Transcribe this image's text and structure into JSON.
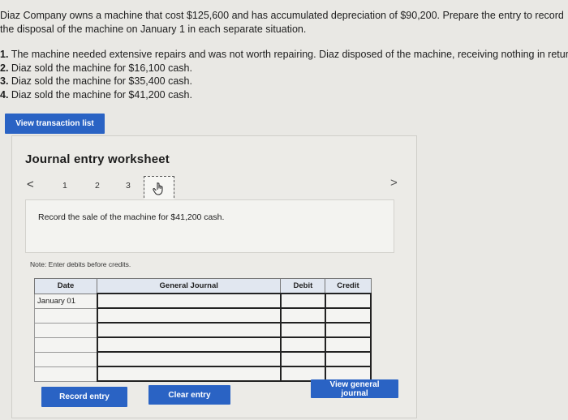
{
  "problem": {
    "intro": "Diaz Company owns a machine that cost $125,600 and has accumulated depreciation of $90,200. Prepare the entry to record the disposal of the machine on January 1 in each separate situation.",
    "items": [
      {
        "num": "1.",
        "text": "The machine needed extensive repairs and was not worth repairing. Diaz disposed of the machine, receiving nothing in return."
      },
      {
        "num": "2.",
        "text": "Diaz sold the machine for $16,100 cash."
      },
      {
        "num": "3.",
        "text": "Diaz sold the machine for $35,400 cash."
      },
      {
        "num": "4.",
        "text": "Diaz sold the machine for $41,200 cash."
      }
    ]
  },
  "buttons": {
    "view_transaction_list": "View transaction list",
    "record_entry": "Record entry",
    "clear_entry": "Clear entry",
    "view_general_journal": "View general journal"
  },
  "worksheet": {
    "title": "Journal entry worksheet",
    "nav_prev": "<",
    "nav_next": ">",
    "steps": [
      "1",
      "2",
      "3"
    ],
    "instruction": "Record the sale of the machine for $41,200 cash.",
    "note": "Note: Enter debits before credits."
  },
  "journal_table": {
    "headers": {
      "date": "Date",
      "general_journal": "General Journal",
      "debit": "Debit",
      "credit": "Credit"
    },
    "rows": [
      {
        "date": "January 01",
        "account": "",
        "debit": "",
        "credit": ""
      },
      {
        "date": "",
        "account": "",
        "debit": "",
        "credit": ""
      },
      {
        "date": "",
        "account": "",
        "debit": "",
        "credit": ""
      },
      {
        "date": "",
        "account": "",
        "debit": "",
        "credit": ""
      },
      {
        "date": "",
        "account": "",
        "debit": "",
        "credit": ""
      },
      {
        "date": "",
        "account": "",
        "debit": "",
        "credit": ""
      }
    ]
  },
  "colors": {
    "accent": "#2a63c4",
    "header_bg": "#e1e7f0"
  },
  "icons": {
    "active_step": "hand-pointer-icon"
  }
}
